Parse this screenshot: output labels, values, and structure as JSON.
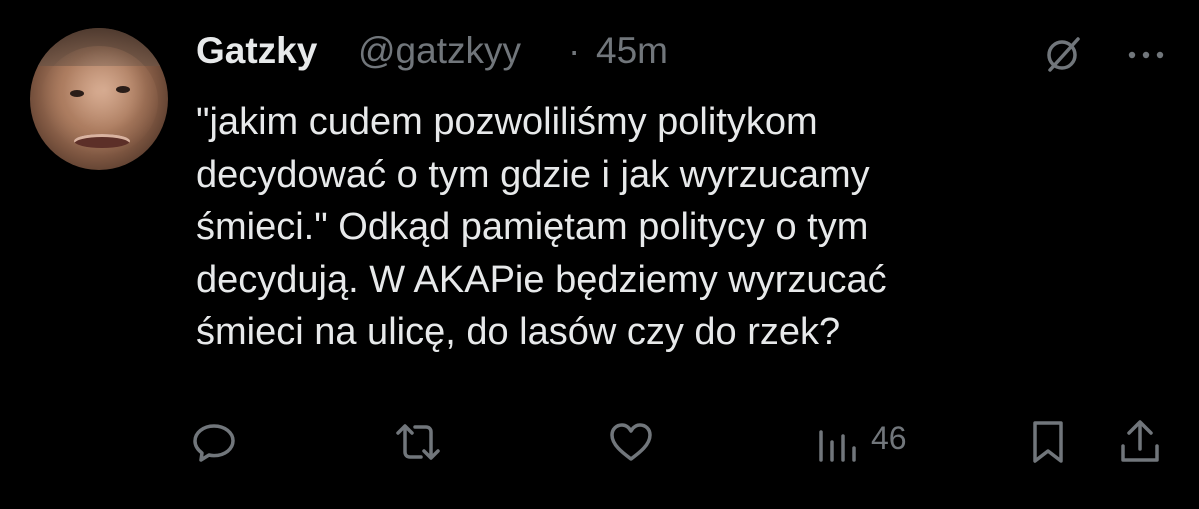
{
  "tweet": {
    "author_name": "Gatzky",
    "handle": "@gatzkyy",
    "separator": "·",
    "time": "45m",
    "text_lines": [
      "\"jakim cudem pozwoliliśmy politykom",
      "decydować o tym gdzie i jak wyrzucamy",
      "śmieci.\" Odkąd pamiętam politycy o tym",
      "decydują. W AKAPie będziemy wyrzucać",
      "śmieci na ulicę, do lasów czy do rzek?"
    ]
  },
  "actions": {
    "views_count": "46"
  },
  "icons": {
    "header": [
      "grok-icon",
      "more-icon"
    ],
    "footer": [
      "reply-icon",
      "retweet-icon",
      "like-icon",
      "views-icon",
      "bookmark-icon",
      "share-icon"
    ]
  },
  "colors": {
    "background": "#000000",
    "text_primary": "#e7e9ea",
    "text_secondary": "#71767b"
  }
}
